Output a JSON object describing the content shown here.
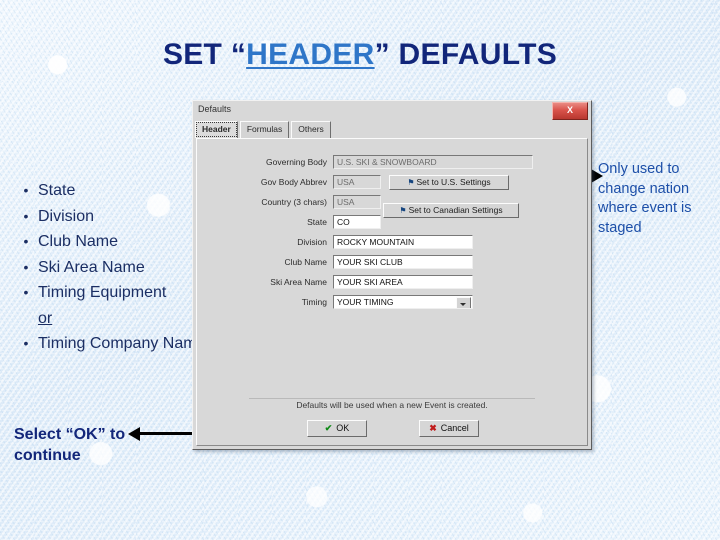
{
  "slide": {
    "title_part1": "SET  “",
    "title_highlight": "HEADER",
    "title_part2": "” DEFAULTS",
    "bullets": [
      {
        "mark": "•",
        "label": "State"
      },
      {
        "mark": "•",
        "label": "Division"
      },
      {
        "mark": "•",
        "label": "Club Name"
      },
      {
        "mark": "•",
        "label": "Ski Area Name"
      },
      {
        "mark": "•",
        "label": "Timing Equipment"
      },
      {
        "mark": "",
        "label": "or"
      },
      {
        "mark": "•",
        "label": "Timing Company Name"
      }
    ],
    "right_note": "Only used to change nation where event is staged",
    "continue_note": "Select “OK” to continue"
  },
  "dialog": {
    "title": "Defaults",
    "close_label": "X",
    "tabs": [
      {
        "label": "Header",
        "selected": true
      },
      {
        "label": "Formulas",
        "selected": false
      },
      {
        "label": "Others",
        "selected": false
      }
    ],
    "fields": [
      {
        "label": "Governing Body",
        "value": "U.S. SKI & SNOWBOARD",
        "disabled": true,
        "combo": false
      },
      {
        "label": "Gov Body Abbrev",
        "value": "USA",
        "disabled": true,
        "combo": false
      },
      {
        "label": "Country (3 chars)",
        "value": "USA",
        "disabled": true,
        "combo": false
      },
      {
        "label": "State",
        "value": "CO",
        "disabled": false,
        "combo": false
      },
      {
        "label": "Division",
        "value": "ROCKY MOUNTAIN",
        "disabled": false,
        "combo": false
      },
      {
        "label": "Club Name",
        "value": "YOUR SKI CLUB",
        "disabled": false,
        "combo": false
      },
      {
        "label": "Ski Area Name",
        "value": "YOUR SKI AREA",
        "disabled": false,
        "combo": false
      },
      {
        "label": "Timing",
        "value": "YOUR TIMING",
        "disabled": false,
        "combo": true
      }
    ],
    "side_buttons": [
      {
        "label": "Set to U.S. Settings"
      },
      {
        "label": "Set to Canadian Settings"
      }
    ],
    "note": "Defaults will be used when a new Event is created.",
    "ok_label": "OK",
    "cancel_label": "Cancel",
    "ok_glyph": "✔",
    "cancel_glyph": "✖"
  }
}
